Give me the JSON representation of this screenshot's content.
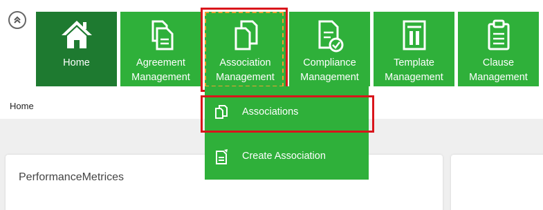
{
  "nav": {
    "tiles": [
      {
        "label": "Home",
        "icon": "home-icon"
      },
      {
        "label": "Agreement\nManagement",
        "icon": "documents-icon"
      },
      {
        "label": "Association\nManagement",
        "icon": "copy-icon"
      },
      {
        "label": "Compliance\nManagement",
        "icon": "compliance-icon"
      },
      {
        "label": "Template\nManagement",
        "icon": "template-icon"
      },
      {
        "label": "Clause\nManagement",
        "icon": "clipboard-icon"
      }
    ],
    "dropdown": [
      {
        "label": "Associations",
        "icon": "copy-icon"
      },
      {
        "label": "Create Association",
        "icon": "edit-document-icon"
      }
    ]
  },
  "breadcrumb": "Home",
  "panels": {
    "left_title": "PerformanceMetrices"
  },
  "colors": {
    "tile_green": "#2fb03a",
    "tile_dark_green": "#1e7a30",
    "highlight_red": "#d9151b",
    "focus_orange": "#f0a030"
  }
}
